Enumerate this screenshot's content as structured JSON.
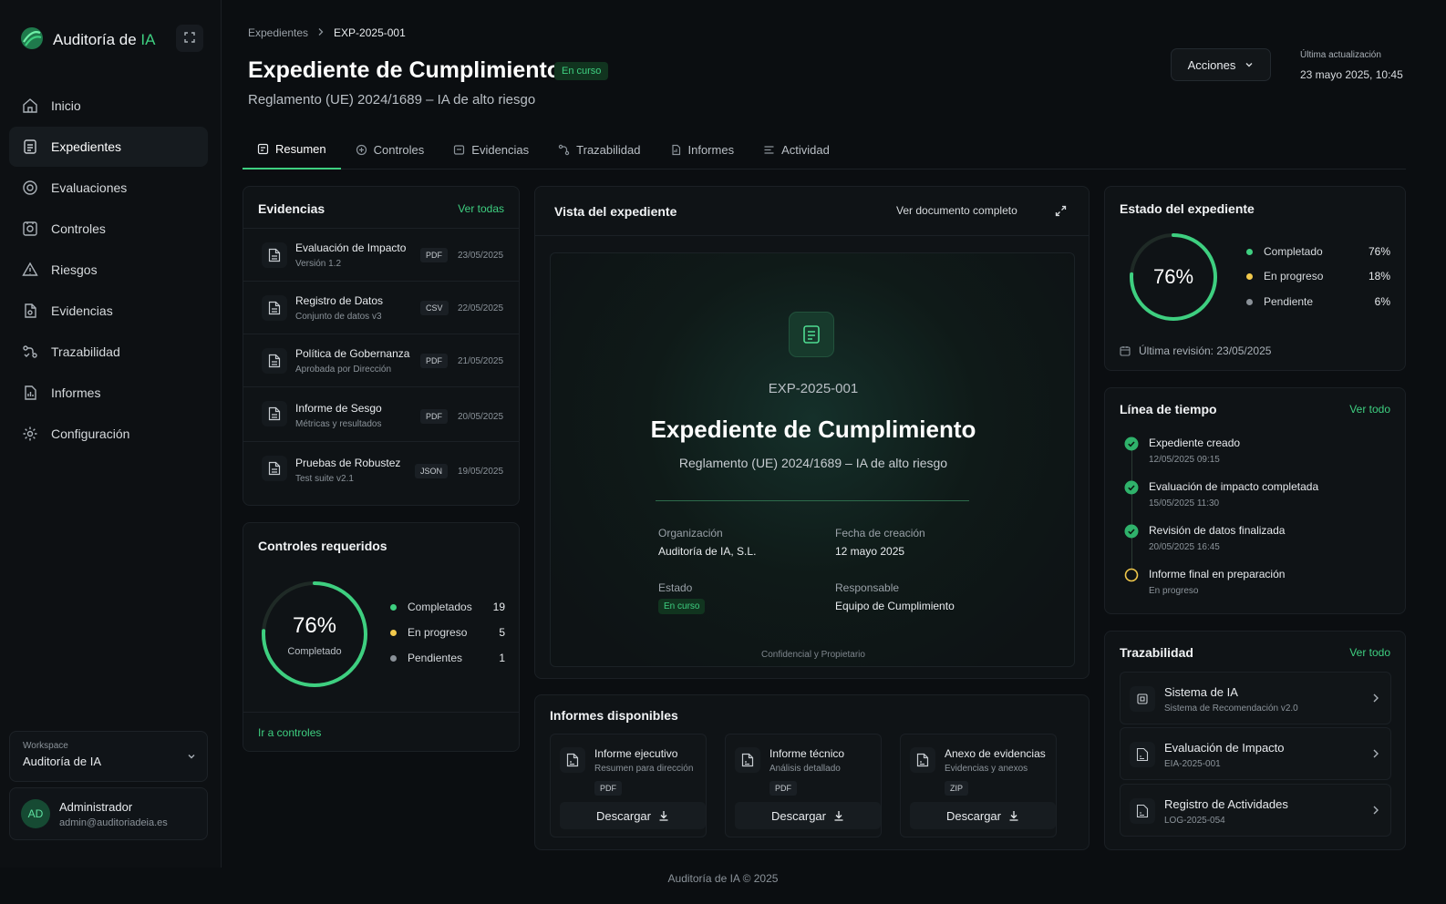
{
  "app": {
    "brand_main": "Auditoría de ",
    "brand_accent": "IA",
    "footer": "Auditoría de IA © 2025"
  },
  "colors": {
    "accent": "#3ecf80",
    "in_progress": "#f2c94c",
    "pending": "#8a9198",
    "background": "#0b0e11"
  },
  "sidebar": {
    "items": [
      {
        "label": "Inicio",
        "icon": "home-icon"
      },
      {
        "label": "Expedientes",
        "icon": "file-icon",
        "active": true
      },
      {
        "label": "Evaluaciones",
        "icon": "target-icon"
      },
      {
        "label": "Controles",
        "icon": "controls-icon"
      },
      {
        "label": "Riesgos",
        "icon": "warning-icon"
      },
      {
        "label": "Evidencias",
        "icon": "evidence-icon"
      },
      {
        "label": "Trazabilidad",
        "icon": "trace-icon"
      },
      {
        "label": "Informes",
        "icon": "report-icon"
      },
      {
        "label": "Configuración",
        "icon": "gear-icon"
      }
    ],
    "workspace": {
      "label": "Workspace",
      "value": "Auditoría de IA"
    },
    "user": {
      "initials": "AD",
      "name": "Administrador",
      "email": "admin@auditoriadeia.es"
    }
  },
  "header": {
    "breadcrumb": {
      "parent": "Expedientes",
      "current": "EXP-2025-001"
    },
    "title": "Expediente de Cumplimiento",
    "status": "En curso",
    "subtitle": "Reglamento (UE) 2024/1689 – IA de alto riesgo",
    "actions_label": "Acciones",
    "update_label": "Última actualización",
    "update_value": "23 mayo 2025, 10:45"
  },
  "tabs": [
    {
      "label": "Resumen",
      "icon": "summary-icon",
      "active": true
    },
    {
      "label": "Controles",
      "icon": "controls-icon"
    },
    {
      "label": "Evidencias",
      "icon": "evidence-icon"
    },
    {
      "label": "Trazabilidad",
      "icon": "trace-icon"
    },
    {
      "label": "Informes",
      "icon": "report-icon"
    },
    {
      "label": "Actividad",
      "icon": "activity-icon"
    }
  ],
  "evidencias": {
    "title": "Evidencias",
    "link": "Ver todas",
    "items": [
      {
        "name": "Evaluación de Impacto",
        "sub": "Versión 1.2",
        "type": "PDF",
        "date": "23/05/2025"
      },
      {
        "name": "Registro de Datos",
        "sub": "Conjunto de datos v3",
        "type": "CSV",
        "date": "22/05/2025"
      },
      {
        "name": "Política de Gobernanza",
        "sub": "Aprobada por Dirección",
        "type": "PDF",
        "date": "21/05/2025"
      },
      {
        "name": "Informe de Sesgo",
        "sub": "Métricas y resultados",
        "type": "PDF",
        "date": "20/05/2025"
      },
      {
        "name": "Pruebas de Robustez",
        "sub": "Test suite v2.1",
        "type": "JSON",
        "date": "19/05/2025"
      }
    ]
  },
  "controles": {
    "title": "Controles requeridos",
    "percent_label": "76%",
    "center_sub": "Completado",
    "progress": 0.76,
    "legend": [
      {
        "label": "Completados",
        "value": "19"
      },
      {
        "label": "En progreso",
        "value": "5"
      },
      {
        "label": "Pendientes",
        "value": "1"
      }
    ],
    "link": "Ir a controles"
  },
  "vista": {
    "title": "Vista del expediente",
    "link": "Ver documento completo",
    "doc": {
      "code": "EXP-2025-001",
      "title": "Expediente de Cumplimiento",
      "subtitle": "Reglamento (UE) 2024/1689 – IA de alto riesgo",
      "org_label": "Organización",
      "org_value": "Auditoría de IA, S.L.",
      "date_label": "Fecha de creación",
      "date_value": "12 mayo 2025",
      "status_label": "Estado",
      "status_value": "En curso",
      "resp_label": "Responsable",
      "resp_value": "Equipo de Cumplimiento",
      "footer": "Confidencial y Propietario"
    }
  },
  "informes": {
    "title": "Informes disponibles",
    "download_label": "Descargar",
    "items": [
      {
        "name": "Informe ejecutivo",
        "sub": "Resumen para dirección",
        "type": "PDF"
      },
      {
        "name": "Informe técnico",
        "sub": "Análisis detallado",
        "type": "PDF"
      },
      {
        "name": "Anexo de evidencias",
        "sub": "Evidencias y anexos",
        "type": "ZIP"
      }
    ]
  },
  "estado": {
    "title": "Estado del expediente",
    "percent_label": "76%",
    "progress": 0.76,
    "legend": [
      {
        "label": "Completado",
        "value": "76%"
      },
      {
        "label": "En progreso",
        "value": "18%"
      },
      {
        "label": "Pendiente",
        "value": "6%"
      }
    ],
    "review": "Última revisión: 23/05/2025"
  },
  "timeline": {
    "title": "Línea de tiempo",
    "link": "Ver todo",
    "items": [
      {
        "title": "Expediente creado",
        "time": "12/05/2025 09:15",
        "state": "done"
      },
      {
        "title": "Evaluación de impacto completada",
        "time": "15/05/2025 11:30",
        "state": "done"
      },
      {
        "title": "Revisión de datos finalizada",
        "time": "20/05/2025 16:45",
        "state": "done"
      },
      {
        "title": "Informe final en preparación",
        "time": "En progreso",
        "state": "progress"
      }
    ]
  },
  "trazabilidad": {
    "title": "Trazabilidad",
    "link": "Ver todo",
    "items": [
      {
        "name": "Sistema de IA",
        "sub": "Sistema de Recomendación v2.0",
        "icon": "chip-icon"
      },
      {
        "name": "Evaluación de Impacto",
        "sub": "EIA-2025-001",
        "icon": "document-icon"
      },
      {
        "name": "Registro de Actividades",
        "sub": "LOG-2025-054",
        "icon": "document-icon"
      }
    ]
  }
}
